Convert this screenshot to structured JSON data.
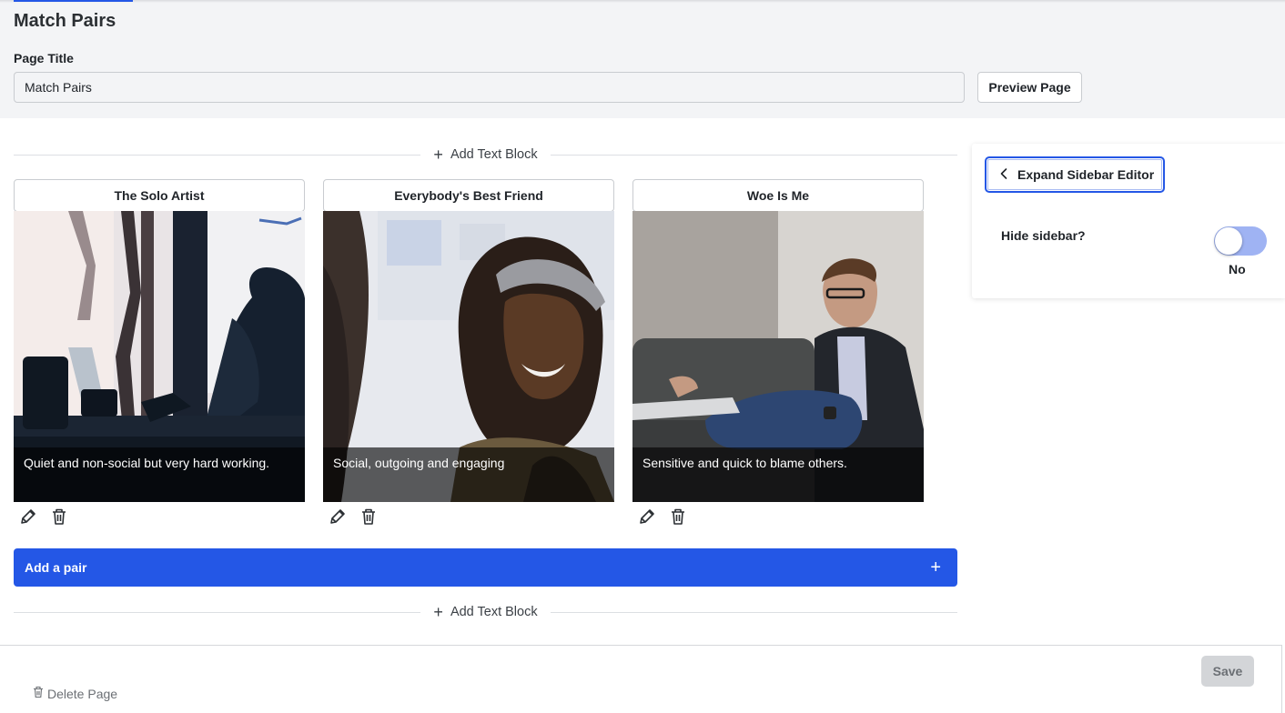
{
  "header": {
    "title": "Match Pairs",
    "page_title_label": "Page Title",
    "page_title_value": "Match Pairs",
    "preview_button": "Preview Page"
  },
  "editor": {
    "add_text_block_label": "Add Text Block",
    "add_pair_label": "Add a pair",
    "cards": [
      {
        "title": "The Solo Artist",
        "caption": "Quiet and non-social but very hard working.",
        "image": "person-silhouette-at-window-with-laptop"
      },
      {
        "title": "Everybody's Best Friend",
        "caption": "Social, outgoing and engaging",
        "image": "smiling-woman-with-headband"
      },
      {
        "title": "Woe Is Me",
        "caption": "Sensitive and quick to blame others.",
        "image": "man-on-sofa-with-laptop"
      }
    ],
    "card_icons": [
      "pencil-icon",
      "trash-icon"
    ]
  },
  "sidebar": {
    "expand_button": "Expand Sidebar Editor",
    "hide_label": "Hide sidebar?",
    "hide_value": "No",
    "toggle_on": false
  },
  "footer": {
    "save_label": "Save",
    "delete_label": "Delete Page"
  },
  "colors": {
    "accent": "#2457e6",
    "toggle_track": "#9fb3f3",
    "background_band": "#f3f4f6"
  }
}
